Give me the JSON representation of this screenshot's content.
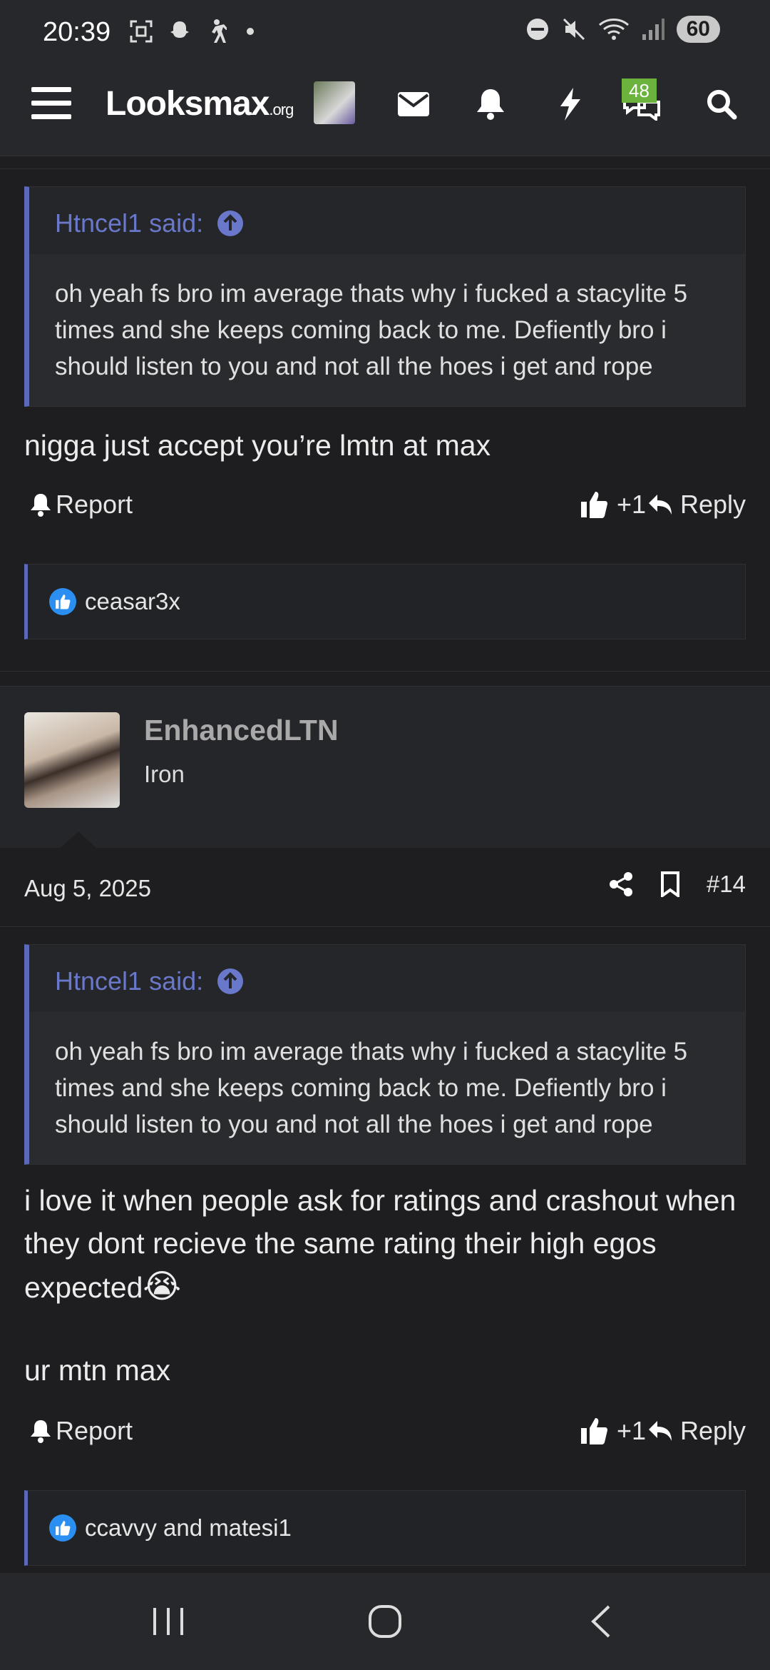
{
  "status_bar": {
    "time": "20:39",
    "battery": "60"
  },
  "header": {
    "logo_main": "Looksmax",
    "logo_suffix": ".org",
    "notif_badge": "48"
  },
  "post13": {
    "quote_author": "Htncel1 said:",
    "quote_text": "oh yeah fs bro im average thats why i fucked a stacylite 5 times and she keeps coming back to me. Defiently bro i should listen to you and not all the hoes i get and rope",
    "body": "nigga just accept you’re lmtn at max",
    "report_label": "Report",
    "like_count": "+1",
    "reply_label": "Reply",
    "reaction_users": "ceasar3x"
  },
  "post14": {
    "username": "EnhancedLTN",
    "user_title": "Iron",
    "date": "Aug 5, 2025",
    "post_number": "#14",
    "quote_author": "Htncel1 said:",
    "quote_text": "oh yeah fs bro im average thats why i fucked a stacylite 5 times and she keeps coming back to me. Defiently bro i should listen to you and not all the hoes i get and rope",
    "body_line1": "i love it when people ask for ratings and crashout when they dont recieve the same rating their high egos expected",
    "body_emoji": "😭",
    "body_line2": "ur mtn max",
    "report_label": "Report",
    "like_count": "+1",
    "reply_label": "Reply",
    "reaction_users": "ccavvy and matesi1"
  },
  "colors": {
    "accent": "#5b69b8",
    "quote_link": "#6a78cc",
    "badge": "#6cb33e",
    "like": "#2a8ff0"
  }
}
